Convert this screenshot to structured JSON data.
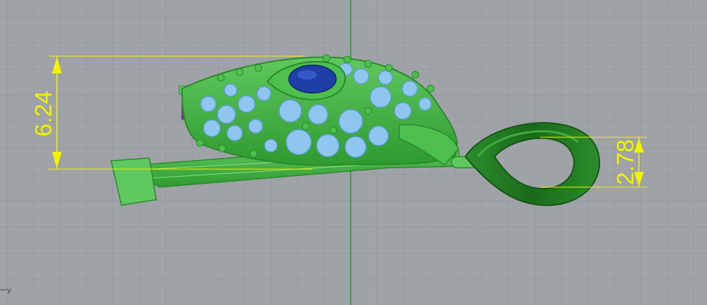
{
  "viewport": {
    "axis_label": "y",
    "colors": {
      "background": "#9fa3a8",
      "grid": "#8e9297",
      "axis_green": "#1aa51a",
      "dimension": "#f2f200",
      "body_green": "#3fb23f",
      "wire_green": "#66d166",
      "gem_blue": "#8fc6ef",
      "eye_blue": "#1e3fa8",
      "bail_green": "#1f7f1f",
      "tag_purple": "#8a2fb5"
    }
  },
  "dimensions": [
    {
      "label": "6.24"
    },
    {
      "label": "2.78"
    }
  ]
}
